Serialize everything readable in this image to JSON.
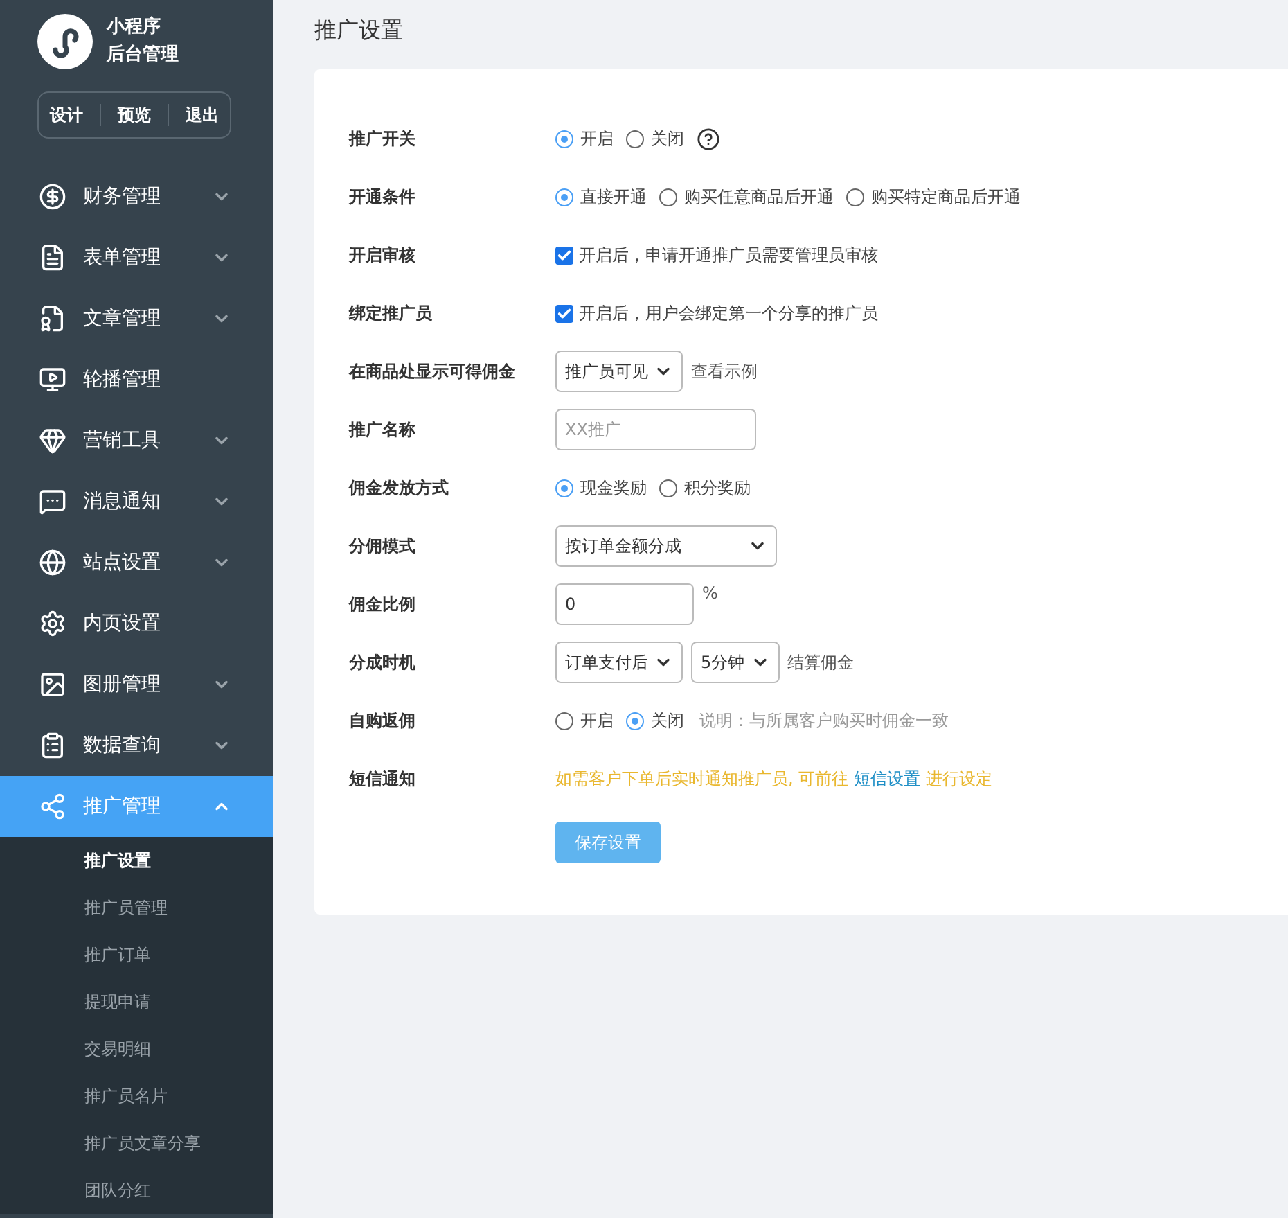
{
  "sidebar": {
    "brand": [
      "小程序",
      "后台管理"
    ],
    "actions": [
      "设计",
      "预览",
      "退出"
    ],
    "menu": [
      {
        "label": "财务管理",
        "expanded": false,
        "selected": false
      },
      {
        "label": "表单管理",
        "expanded": false,
        "selected": false
      },
      {
        "label": "文章管理",
        "expanded": false,
        "selected": false
      },
      {
        "label": "轮播管理",
        "selected": false
      },
      {
        "label": "营销工具",
        "expanded": false,
        "selected": false
      },
      {
        "label": "消息通知",
        "expanded": false,
        "selected": false
      },
      {
        "label": "站点设置",
        "expanded": false,
        "selected": false
      },
      {
        "label": "内页设置",
        "selected": false
      },
      {
        "label": "图册管理",
        "expanded": false,
        "selected": false
      },
      {
        "label": "数据查询",
        "expanded": false,
        "selected": false
      },
      {
        "label": "推广管理",
        "expanded": true,
        "selected": true,
        "children": [
          {
            "label": "推广设置",
            "selected": true
          },
          {
            "label": "推广员管理",
            "selected": false
          },
          {
            "label": "推广订单",
            "selected": false
          },
          {
            "label": "提现申请",
            "selected": false
          },
          {
            "label": "交易明细",
            "selected": false
          },
          {
            "label": "推广员名片",
            "selected": false
          },
          {
            "label": "推广员文章分享",
            "selected": false
          },
          {
            "label": "团队分红",
            "selected": false
          }
        ]
      }
    ]
  },
  "page_title": "推广设置",
  "form": [
    {
      "label": "推广开关",
      "kind": "radio",
      "help": true,
      "options": [
        {
          "label": "开启",
          "selected": true
        },
        {
          "label": "关闭",
          "selected": false
        }
      ]
    },
    {
      "label": "开通条件",
      "kind": "radio",
      "options": [
        {
          "label": "直接开通",
          "selected": true
        },
        {
          "label": "购买任意商品后开通",
          "selected": false
        },
        {
          "label": "购买特定商品后开通",
          "selected": false
        }
      ]
    },
    {
      "label": "开启审核",
      "kind": "checkbox",
      "checked": true,
      "text": "开启后，申请开通推广员需要管理员审核"
    },
    {
      "label": "绑定推广员",
      "kind": "checkbox",
      "checked": true,
      "text": "开启后，用户会绑定第一个分享的推广员"
    },
    {
      "label": "在商品处显示可得佣金",
      "kind": "select",
      "selects": [
        "推广员可见"
      ],
      "link": "查看示例"
    },
    {
      "label": "推广名称",
      "kind": "input",
      "placeholder": "XX推广"
    },
    {
      "label": "佣金发放方式",
      "kind": "radio",
      "options": [
        {
          "label": "现金奖励",
          "selected": true
        },
        {
          "label": "积分奖励",
          "selected": false
        }
      ]
    },
    {
      "label": "分佣模式",
      "kind": "select",
      "wide": true,
      "selects": [
        "按订单金额分成"
      ]
    },
    {
      "label": "佣金比例",
      "kind": "input",
      "value": "0",
      "suffix": "%"
    },
    {
      "label": "分成时机",
      "kind": "select",
      "selects": [
        "订单支付后",
        "5分钟"
      ],
      "suffix": "结算佣金"
    },
    {
      "label": "自购返佣",
      "kind": "radio",
      "note": "说明：与所属客户购买时佣金一致",
      "options": [
        {
          "label": "开启",
          "selected": false
        },
        {
          "label": "关闭",
          "selected": true
        }
      ]
    },
    {
      "label": "短信通知",
      "kind": "notice",
      "text": "如需客户下单后实时通知推广员, 可前往",
      "link": "短信设置",
      "text_after": "进行设定"
    }
  ],
  "save_button": "保存设置"
}
